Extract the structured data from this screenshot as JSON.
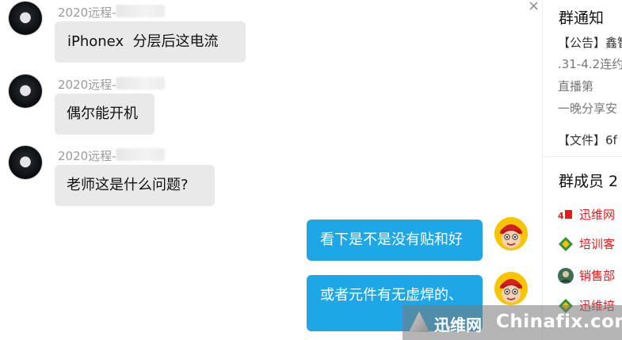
{
  "chat": {
    "messages": [
      {
        "sender": "2020远程-",
        "text": "iPhonex  分层后这电流"
      },
      {
        "sender": "2020远程-",
        "text": "偶尔能开机"
      },
      {
        "sender": "2020远程-",
        "text": "老师这是什么问题?"
      },
      {
        "text": "看下是不是没有贴和好"
      },
      {
        "text": "或者元件有无虚焊的、"
      }
    ],
    "close_glyph": "×"
  },
  "panel": {
    "notice_title": "群通知",
    "notice_lines": [
      "【公告】鑫智",
      ".31-4.2连约",
      "直播第",
      "一晚分享安"
    ],
    "file_line": "【文件】6f",
    "members_title": "群成员 2",
    "members": [
      {
        "name": "迅维网",
        "icon": "red-badge-icon",
        "color": "#e21d1d"
      },
      {
        "name": "培训客",
        "icon": "diamond-icon",
        "color": "#e21d1d"
      },
      {
        "name": "销售部",
        "icon": "person-icon",
        "color": "#e21d1d"
      },
      {
        "name": "迅维培",
        "icon": "diamond-icon",
        "color": "#e21d1d"
      }
    ]
  },
  "watermark": {
    "cn": "迅维网",
    "en": "Chinafix.com"
  },
  "colors": {
    "bubble_right": "#1ea7e6",
    "bubble_left": "#e9e9e9",
    "member_name": "#e21d1d"
  }
}
